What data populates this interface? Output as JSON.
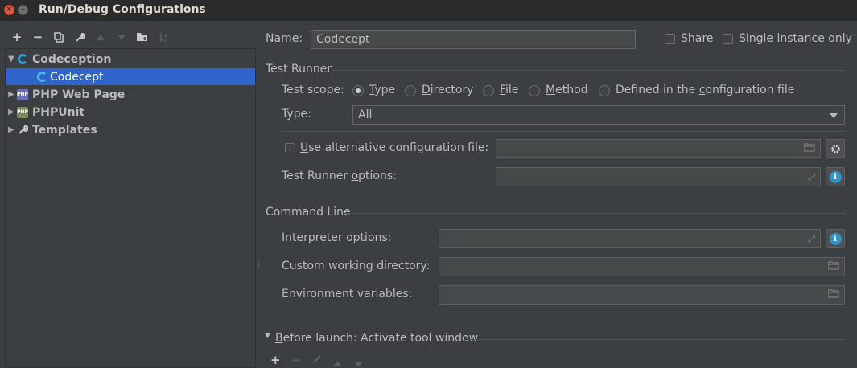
{
  "window": {
    "title": "Run/Debug Configurations"
  },
  "left_toolbar": {
    "add": "+",
    "remove": "−",
    "copy": "⧉",
    "edit": "🔧",
    "up": "▲",
    "down": "▼",
    "folder": "▣",
    "sort": "↓ᵃ"
  },
  "tree": {
    "items": [
      {
        "label": "Codeception",
        "expanded": true,
        "icon": "codeception-icon"
      },
      {
        "label": "Codecept",
        "selected": true,
        "icon": "codeception-icon"
      },
      {
        "label": "PHP Web Page",
        "expanded": false,
        "icon": "php-icon"
      },
      {
        "label": "PHPUnit",
        "expanded": false,
        "icon": "phpunit-icon"
      },
      {
        "label": "Templates",
        "expanded": false,
        "icon": "wrench-icon"
      }
    ]
  },
  "header": {
    "name_label_pre": "",
    "name_label_u": "N",
    "name_label_post": "ame:",
    "name_value": "Codecept",
    "share_label_u": "S",
    "share_label_post": "hare",
    "single_pre": "Single ",
    "single_u": "i",
    "single_post": "nstance only"
  },
  "test_runner": {
    "section_title": "Test Runner",
    "scope_label": "Test scope:",
    "scope_options": [
      {
        "pre": "",
        "u": "T",
        "post": "ype",
        "selected": true
      },
      {
        "pre": "",
        "u": "D",
        "post": "irectory",
        "selected": false
      },
      {
        "pre": "",
        "u": "F",
        "post": "ile",
        "selected": false
      },
      {
        "pre": "",
        "u": "M",
        "post": "ethod",
        "selected": false
      },
      {
        "pre": "Defined in the ",
        "u": "c",
        "post": "onfiguration file",
        "selected": false
      }
    ],
    "type_label": "Type:",
    "type_value": "All",
    "alt_config_u": "U",
    "alt_config_post": "se alternative configuration file:",
    "alt_config_value": "",
    "options_pre": "Test Runner ",
    "options_u": "o",
    "options_post": "ptions:",
    "options_value": ""
  },
  "command_line": {
    "section_title": "Command Line",
    "interpreter_label": "Interpreter options:",
    "interpreter_value": "",
    "workdir_label": "Custom working directory:",
    "workdir_value": "",
    "env_label": "Environment variables:",
    "env_value": ""
  },
  "before_launch": {
    "title_u": "B",
    "title_post": "efore launch: Activate tool window",
    "add": "+",
    "remove": "−",
    "edit": "✎",
    "up": "▲",
    "down": "▼"
  },
  "colors": {
    "background": "#3c3f41",
    "selection": "#2f65ca",
    "info": "#3592c4"
  }
}
